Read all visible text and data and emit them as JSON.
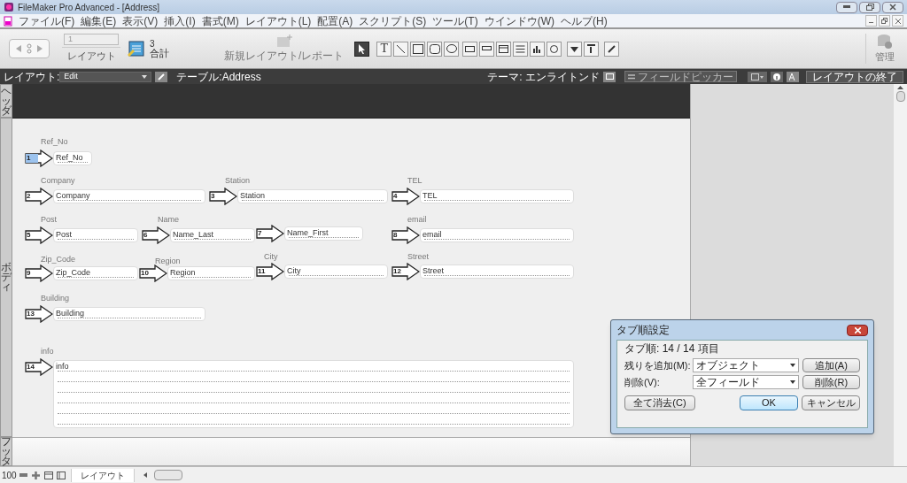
{
  "window": {
    "title": "FileMaker Pro Advanced - [Address]"
  },
  "menu": [
    "ファイル(F)",
    "編集(E)",
    "表示(V)",
    "挿入(I)",
    "書式(M)",
    "レイアウト(L)",
    "配置(A)",
    "スクリプト(S)",
    "ツール(T)",
    "ウインドウ(W)",
    "ヘルプ(H)"
  ],
  "toolbar": {
    "record": "1",
    "record_label": "レイアウト",
    "count": "3",
    "count_label": "合計",
    "new_layout": {
      "label": "新規レイアウト/レポート",
      "disabled": true
    },
    "tools": [
      {
        "kind": "pointer",
        "selected": true
      },
      {
        "kind": "text",
        "label": "T",
        "selected": false
      },
      {
        "kind": "line",
        "selected": false
      },
      {
        "kind": "rect",
        "selected": false
      },
      {
        "kind": "rounded",
        "selected": false
      },
      {
        "kind": "oval",
        "selected": false
      }
    ],
    "manage": "管理"
  },
  "layout_bar": {
    "layout_label": "レイアウト:",
    "layout": "Edit",
    "table": "テーブル:Address",
    "theme": "テーマ: エンライトンド",
    "field_picker": {
      "label": "フィールドピッカー",
      "disabled": true
    },
    "exit": "レイアウトの終了"
  },
  "parts": [
    {
      "label": "ヘッダ"
    },
    {
      "label": "ボディ"
    },
    {
      "label": "フッタ"
    }
  ],
  "fields": [
    {
      "label": "Ref_No",
      "name": "Ref_No",
      "tab": "1",
      "selected": true
    },
    {
      "label": "Company",
      "name": "Company",
      "tab": "2",
      "selected": false
    },
    {
      "label": "Station",
      "name": "Station",
      "tab": "3",
      "selected": false
    },
    {
      "label": "TEL",
      "name": "TEL",
      "tab": "4",
      "selected": false
    },
    {
      "label": "Post",
      "name": "Post",
      "tab": "5",
      "selected": false
    },
    {
      "label": "Name",
      "name": "Name_Last",
      "tab": "6",
      "selected": false
    },
    {
      "name": "Name_First",
      "tab": "7",
      "selected": false
    },
    {
      "label": "email",
      "name": "email",
      "tab": "8",
      "selected": false
    },
    {
      "label": "Zip_Code",
      "name": "Zip_Code",
      "tab": "9",
      "selected": false
    },
    {
      "label": "Region",
      "name": "Region",
      "tab": "10",
      "selected": false
    },
    {
      "label": "City",
      "name": "City",
      "tab": "11",
      "selected": false
    },
    {
      "label": "Street",
      "name": "Street",
      "tab": "12",
      "selected": false
    },
    {
      "label": "Building",
      "name": "Building",
      "tab": "13",
      "selected": false
    },
    {
      "label": "info",
      "name": "info",
      "tab": "14",
      "selected": false
    }
  ],
  "dialog": {
    "title": "タブ順設定",
    "count": "タブ順: 14 / 14 項目",
    "rows": [
      {
        "label": "残りを追加(M):",
        "value": "オブジェクト",
        "button": "追加(A)"
      },
      {
        "label": "削除(V):",
        "value": "全フィールド",
        "button": "削除(R)"
      }
    ],
    "buttons": [
      {
        "label": "全て消去(C)",
        "default": false
      },
      {
        "label": "OK",
        "default": true
      },
      {
        "label": "キャンセル",
        "default": false
      }
    ]
  },
  "status_bar": {
    "zoom": "100",
    "mode": "レイアウト"
  }
}
